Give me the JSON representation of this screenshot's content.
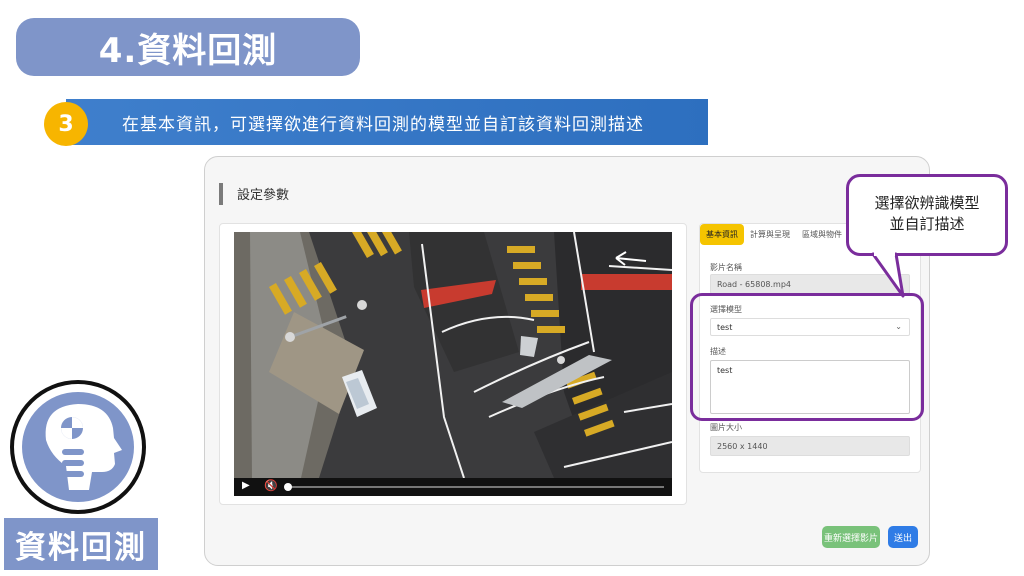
{
  "title": "4.資料回測",
  "step": {
    "number": "3",
    "text": "在基本資訊，可選擇欲進行資料回測的模型並自訂該資料回測描述"
  },
  "panel": {
    "title": "設定參數",
    "tabs": [
      {
        "label": "基本資訊",
        "active": true
      },
      {
        "label": "計算與呈現",
        "active": false
      },
      {
        "label": "區域與物件",
        "active": false
      }
    ],
    "video_name_label": "影片名稱",
    "video_name_value": "Road - 65808.mp4",
    "model_label": "選擇模型",
    "model_value": "test",
    "description_label": "描述",
    "description_value": "test",
    "image_size_label": "圖片大小",
    "image_size_value": "2560 x 1440",
    "reselect_button": "重新選擇影片",
    "submit_button": "送出"
  },
  "callout": {
    "line1": "選擇欲辨識模型",
    "line2": "並自訂描述"
  },
  "bottom_label": "資料回測",
  "colors": {
    "title_bg": "#7f95c9",
    "step_bar": "#3f7fcc",
    "step_circle": "#f7b500",
    "highlight": "#7a2d9c",
    "active_tab": "#f5c400",
    "reselect_btn": "#79c27a",
    "submit_btn": "#2f7ce6"
  },
  "icons": {
    "play": "play-icon",
    "mute": "mute-icon",
    "dropdown": "chevron-down-icon",
    "head": "head-profile-icon"
  }
}
